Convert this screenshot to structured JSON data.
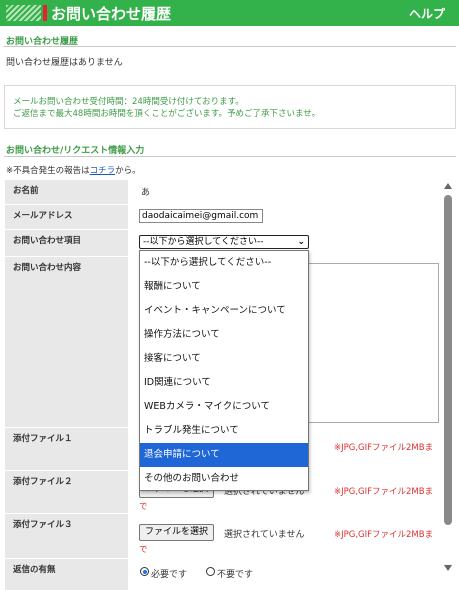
{
  "header": {
    "title": "お問い合わせ履歴",
    "help_label": "ヘルプ"
  },
  "history": {
    "title": "お問い合わせ履歴",
    "empty_text": "問い合わせ履歴はありません"
  },
  "notice": {
    "line1": "メールお問い合わせ受付時間：24時間受け付けております。",
    "line2": "ご返信まで最大48時間お時間を頂くことがございます。予めご了承下さいませ。"
  },
  "form": {
    "title": "お問い合わせ/リクエスト情報入力",
    "note_prefix": "※不具合発生の報告は",
    "note_link": "コチラ",
    "note_suffix": "から。",
    "name_label": "お名前",
    "name_value": "あ",
    "email_label": "メールアドレス",
    "email_value": "daodaicaimei@gmail.com",
    "category_label": "お問い合わせ項目",
    "category_selected": "--以下から選択してください--",
    "content_label": "お問い合わせ内容",
    "file1_label": "添付ファイル１",
    "file2_label": "添付ファイル２",
    "file3_label": "添付ファイル３",
    "file_button": "ファイルを選択",
    "file_status": "選択されていません",
    "file_note": "※JPG,GIFファイル2MBま",
    "file_note_cont": "で",
    "reply_label": "返信の有無",
    "reply_yes": "必要です",
    "reply_no": "不要です"
  },
  "dropdown": {
    "options": [
      "--以下から選択してください--",
      "報酬について",
      "イベント・キャンペーンについて",
      "操作方法について",
      "接客について",
      "ID関連について",
      "WEBカメラ・マイクについて",
      "トラブル発生について",
      "退会申請について",
      "その他のお問い合わせ"
    ],
    "highlighted": "退会申請について"
  },
  "colors": {
    "brand_green": "#33b14a",
    "accent_red": "#e8202f",
    "highlight_blue": "#1f66d6"
  }
}
